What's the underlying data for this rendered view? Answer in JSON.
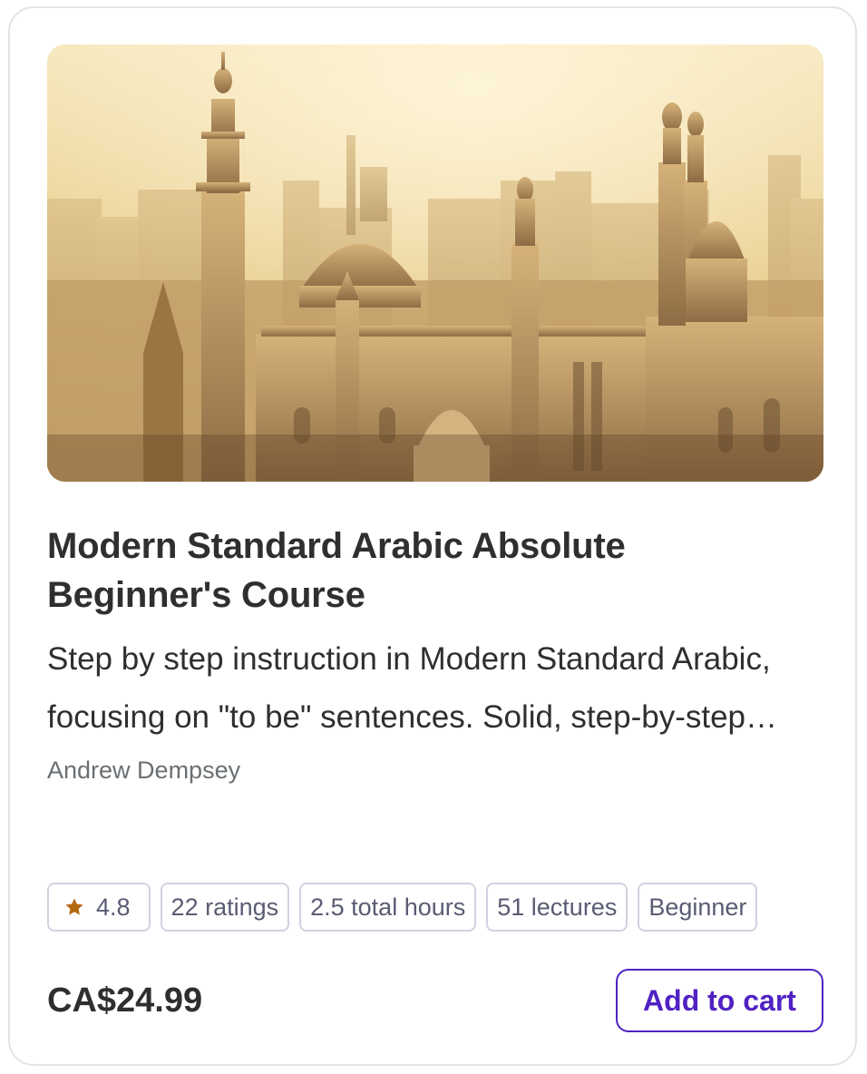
{
  "course": {
    "title": "Modern Standard Arabic Absolute Beginner's Course",
    "description": "Step by step instruction in Modern Standard Arabic, focusing on \"to be\" sentences. Solid, step-by-step foundations.",
    "author": "Andrew Dempsey",
    "thumbnail_icon": "mosque-skyline-photo",
    "rating": "4.8",
    "rating_icon": "star-icon",
    "ratings_count": "22 ratings",
    "total_hours": "2.5 total hours",
    "lectures": "51 lectures",
    "level": "Beginner",
    "price": "CA$24.99",
    "add_to_cart_label": "Add to cart"
  },
  "colors": {
    "accent": "#5022c3",
    "star": "#b4690e",
    "title_text": "#2d2f31",
    "muted_text": "#6a6f73",
    "badge_border": "#d1d2e0"
  }
}
